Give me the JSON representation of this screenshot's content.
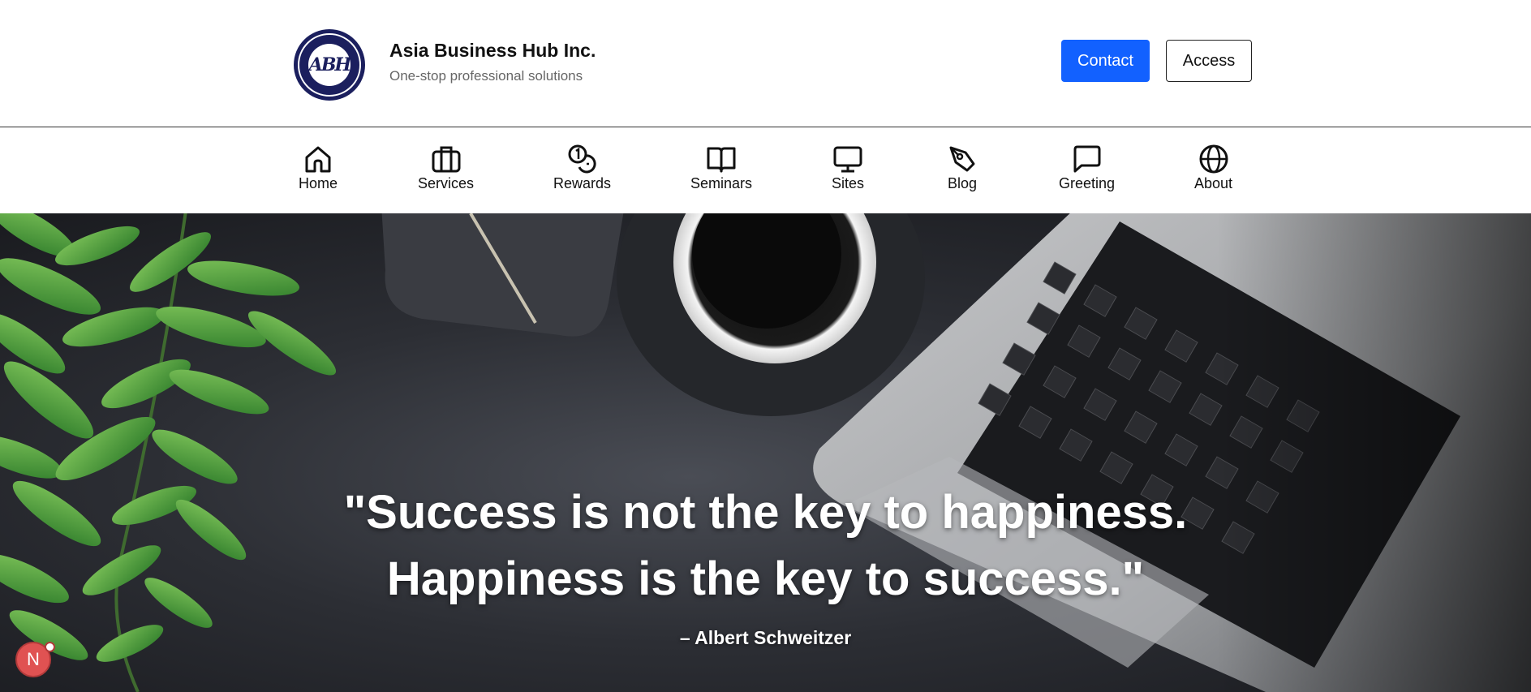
{
  "brand": {
    "logo_text": "ABH",
    "title": "Asia Business Hub Inc.",
    "tagline": "One-stop professional solutions"
  },
  "header": {
    "contact_label": "Contact",
    "access_label": "Access",
    "accent_color": "#1261ff"
  },
  "nav": {
    "items": [
      {
        "label": "Home",
        "icon": "home-icon"
      },
      {
        "label": "Services",
        "icon": "briefcase-icon"
      },
      {
        "label": "Rewards",
        "icon": "coins-icon"
      },
      {
        "label": "Seminars",
        "icon": "book-icon"
      },
      {
        "label": "Sites",
        "icon": "monitor-icon"
      },
      {
        "label": "Blog",
        "icon": "pen-icon"
      },
      {
        "label": "Greeting",
        "icon": "chat-icon"
      },
      {
        "label": "About",
        "icon": "globe-icon"
      }
    ]
  },
  "hero": {
    "quote_line1": "\"Success is not the key to happiness.",
    "quote_line2": "Happiness is the key to success.\"",
    "author": "– Albert Schweitzer"
  },
  "fab": {
    "label": "N",
    "color": "#e05252"
  }
}
